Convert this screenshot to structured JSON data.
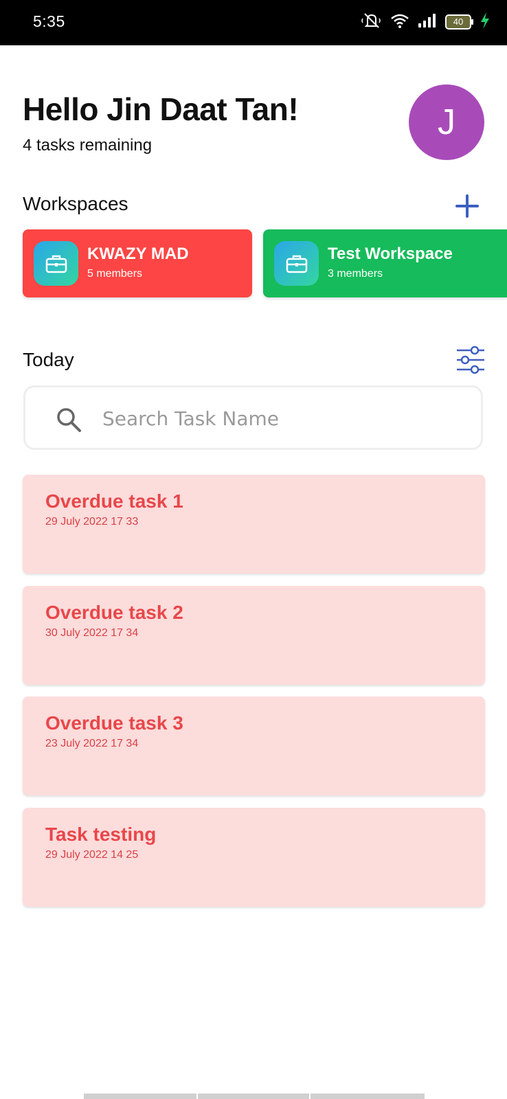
{
  "status_bar": {
    "time": "5:35",
    "battery": "40",
    "icons": [
      "mute-icon",
      "wifi-icon",
      "signal-icon",
      "battery-icon",
      "charging-icon"
    ]
  },
  "header": {
    "greeting": "Hello Jin Daat Tan!",
    "subtitle": "4 tasks remaining",
    "avatar_initial": "J",
    "avatar_color": "#a84bb9"
  },
  "workspaces": {
    "label": "Workspaces",
    "add_icon": "plus-icon",
    "items": [
      {
        "name": "KWAZY MAD",
        "members": "5 members",
        "color": "#fc4544",
        "icon": "briefcase-icon"
      },
      {
        "name": "Test Workspace",
        "members": "3 members",
        "color": "#16bb5b",
        "icon": "briefcase-icon"
      }
    ]
  },
  "today": {
    "label": "Today",
    "filter_icon": "sliders-icon"
  },
  "search": {
    "placeholder": "Search Task Name",
    "value": "",
    "icon": "search-icon"
  },
  "tasks": [
    {
      "title": "Overdue task 1",
      "date": "29 July 2022 17 33"
    },
    {
      "title": "Overdue task 2",
      "date": "30 July 2022 17 34"
    },
    {
      "title": "Overdue task 3",
      "date": "23 July 2022 17 34"
    },
    {
      "title": "Task testing",
      "date": "29 July 2022 14 25"
    }
  ],
  "colors": {
    "accent": "#3d5fbf",
    "task_bg": "#fddcdc",
    "task_text": "#e8474a"
  }
}
